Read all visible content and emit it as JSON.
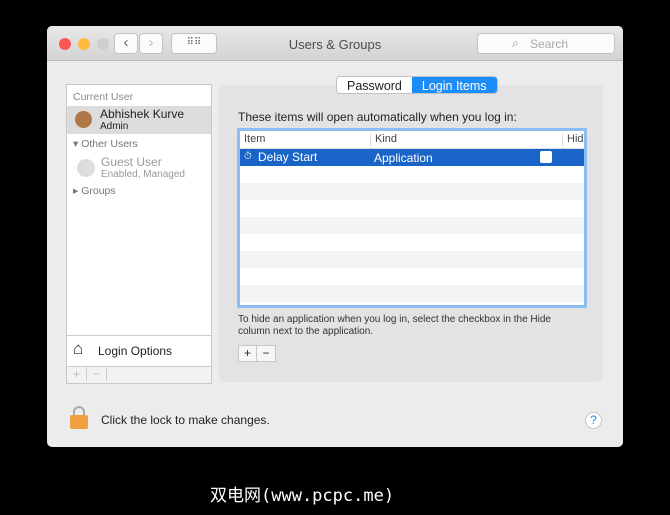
{
  "window": {
    "title": "Users & Groups",
    "search_placeholder": "Search"
  },
  "sidebar": {
    "current_user_header": "Current User",
    "current_user": {
      "name": "Abhishek Kurve",
      "role": "Admin"
    },
    "other_users_header": "Other Users",
    "guest": {
      "name": "Guest User",
      "status": "Enabled, Managed"
    },
    "groups": "Groups",
    "login_options": "Login Options",
    "add": "+",
    "remove": "−"
  },
  "tabs": [
    {
      "label": "Password"
    },
    {
      "label": "Login Items",
      "active": true
    }
  ],
  "login_items": {
    "intro": "These items will open automatically when you log in:",
    "columns": [
      "Item",
      "Kind",
      "Hide"
    ],
    "rows": [
      {
        "item": "Delay Start",
        "kind": "Application",
        "hide": false
      }
    ],
    "help_text": "To hide an application when you log in, select the checkbox in the Hide column next to the application.",
    "add": "+",
    "remove": "−"
  },
  "footer": {
    "lock_text": "Click the lock to make changes.",
    "help": "?"
  },
  "watermark": "双电网(www.pcpc.me)",
  "colors": {
    "accent": "#1c8cf8",
    "selection": "#1a64c8"
  }
}
